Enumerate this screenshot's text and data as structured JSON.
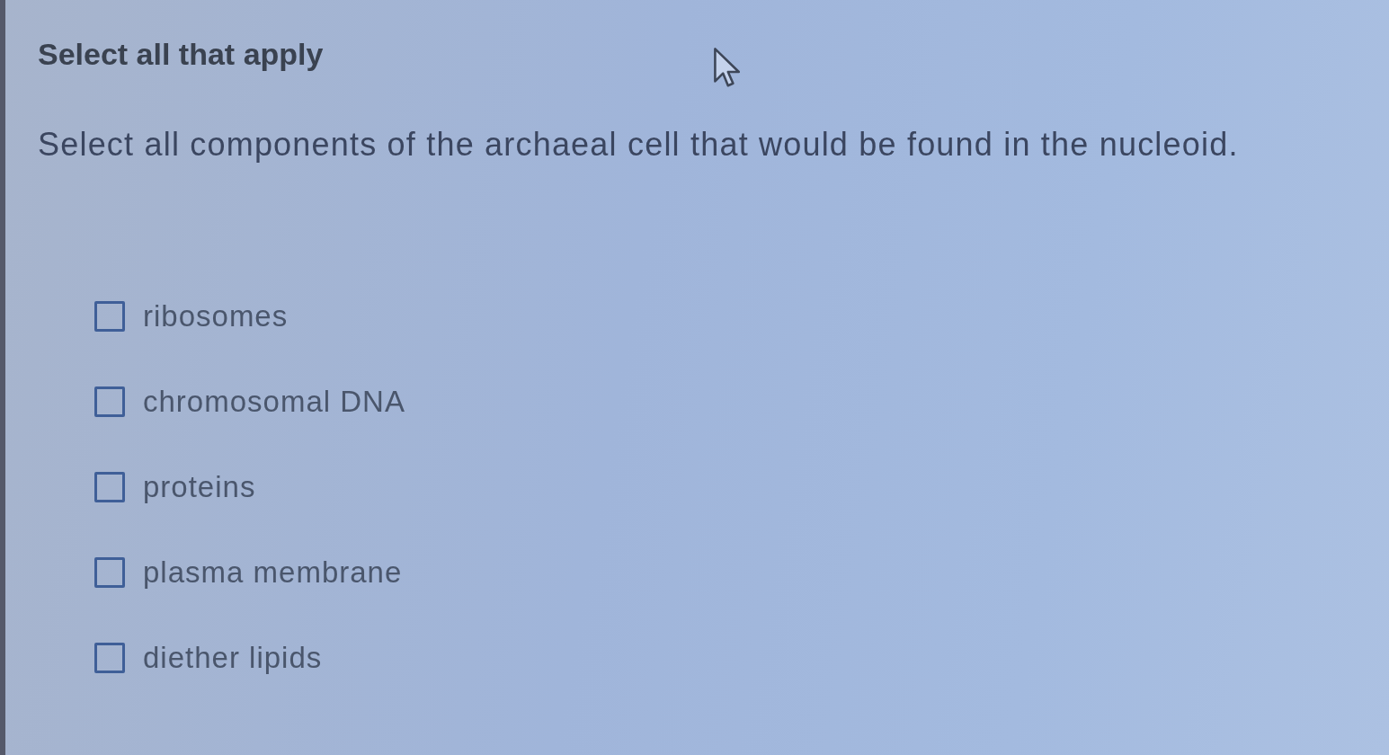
{
  "header": {
    "title": "Select all that apply"
  },
  "question": {
    "text": "Select all components of the archaeal cell that would be found in the nucleoid."
  },
  "options": [
    {
      "label": "ribosomes",
      "checked": false
    },
    {
      "label": "chromosomal DNA",
      "checked": false
    },
    {
      "label": "proteins",
      "checked": false
    },
    {
      "label": "plasma membrane",
      "checked": false
    },
    {
      "label": "diether lipids",
      "checked": false
    }
  ]
}
